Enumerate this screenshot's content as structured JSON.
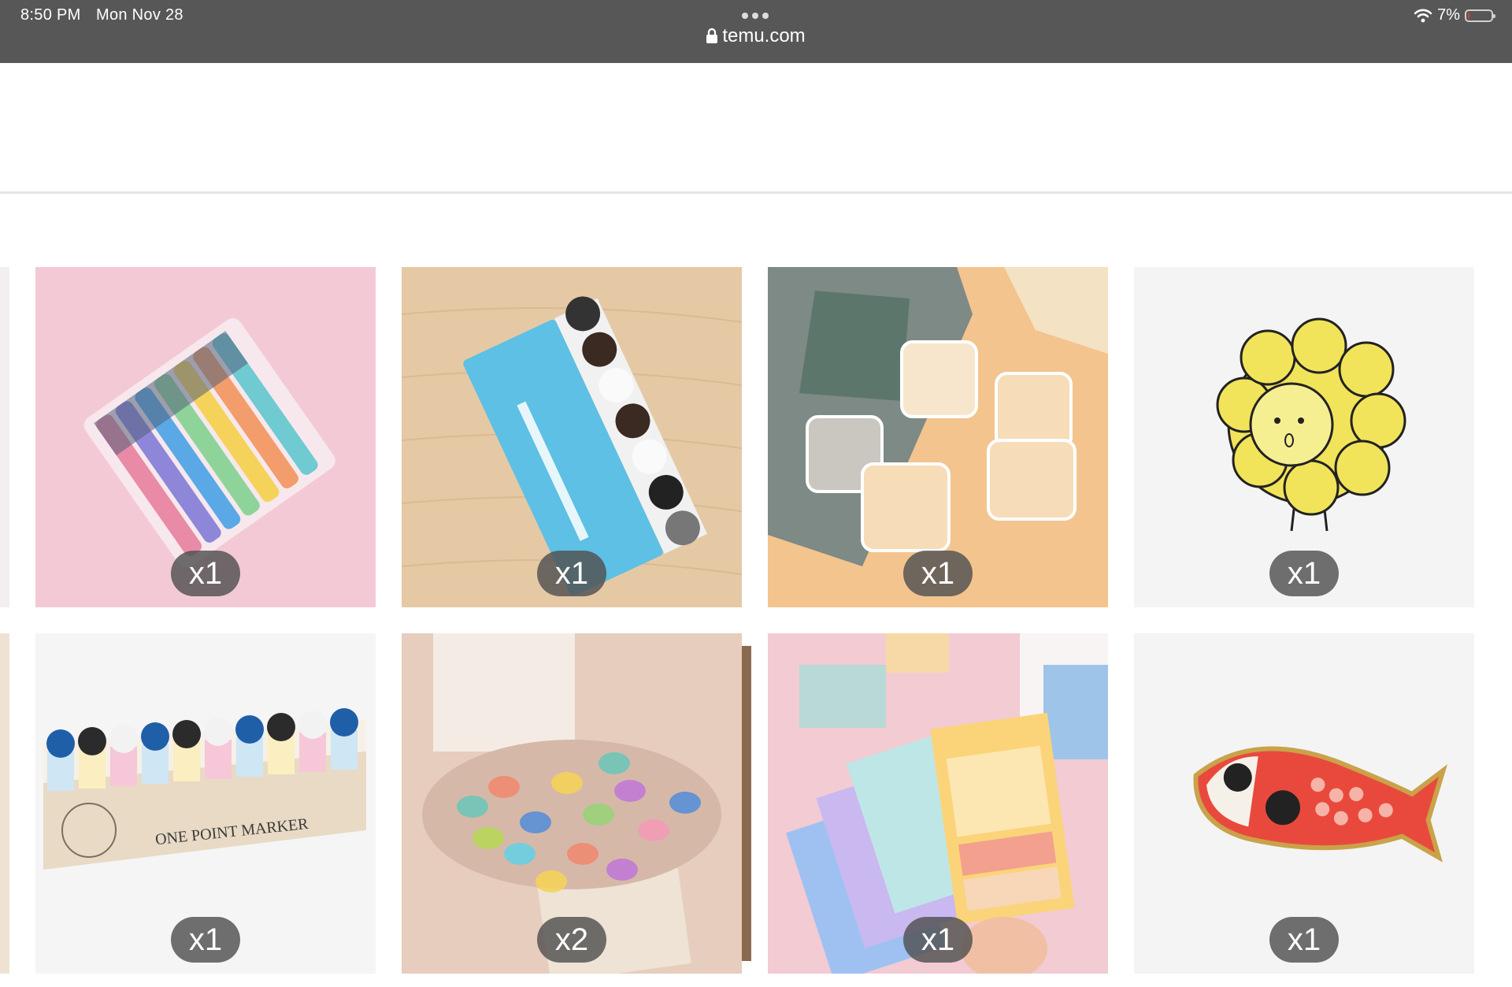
{
  "status_bar": {
    "time": "8:50 PM",
    "date": "Mon Nov 28",
    "url": "temu.com",
    "battery": "7%",
    "battery_level": 0.07,
    "accent_low_battery": "#e23b3b"
  },
  "products": [
    {
      "qty": "x1",
      "icon": "pens-image"
    },
    {
      "qty": "x1",
      "icon": "sticky-marker-image"
    },
    {
      "qty": "x1",
      "icon": "plastic-boxes-image"
    },
    {
      "qty": "x1",
      "icon": "flower-pin-image"
    },
    {
      "qty": "x1",
      "icon": "one-point-marker-image",
      "printed_text": "ONE POINT MARKER"
    },
    {
      "qty": "x2",
      "icon": "glass-pebbles-image"
    },
    {
      "qty": "x1",
      "icon": "sticky-notes-image"
    },
    {
      "qty": "x1",
      "icon": "koi-fish-pin-image"
    }
  ]
}
